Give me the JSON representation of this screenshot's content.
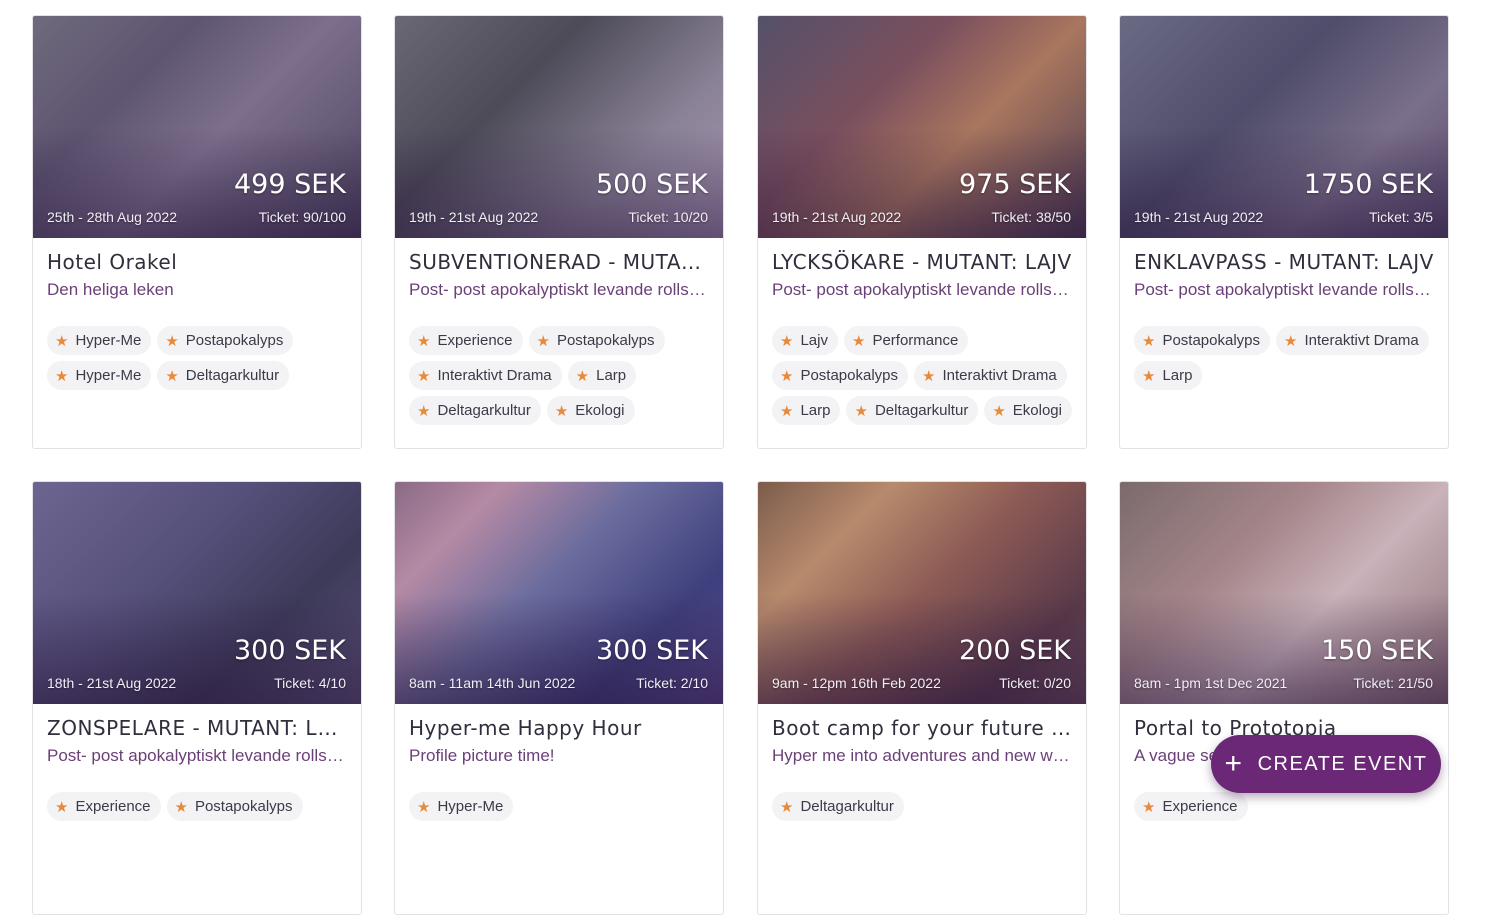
{
  "create_event_label": "CREATE EVENT",
  "accent_color": "#6a2877",
  "tag_star_color": "#e98a3a",
  "cards": [
    {
      "price": "499 SEK",
      "date": "25th - 28th Aug 2022",
      "ticket": "Ticket: 90/100",
      "title": "Hotel Orakel",
      "subtitle": "Den heliga leken",
      "tags": [
        "Hyper-Me",
        "Postapokalyps",
        "Hyper-Me",
        "Deltagarkultur"
      ]
    },
    {
      "price": "500 SEK",
      "date": "19th - 21st Aug 2022",
      "ticket": "Ticket: 10/20",
      "title": "SUBVENTIONERAD - MUTANT: LAJV",
      "subtitle": "Post- post apokalyptiskt levande rollspel",
      "tags": [
        "Experience",
        "Postapokalyps",
        "Interaktivt Drama",
        "Larp",
        "Deltagarkultur",
        "Ekologi"
      ]
    },
    {
      "price": "975 SEK",
      "date": "19th - 21st Aug 2022",
      "ticket": "Ticket: 38/50",
      "title": "LYCKSÖKARE - MUTANT: LAJV",
      "subtitle": "Post- post apokalyptiskt levande rollspel",
      "tags": [
        "Lajv",
        "Performance",
        "Postapokalyps",
        "Interaktivt Drama",
        "Larp",
        "Deltagarkultur",
        "Ekologi"
      ]
    },
    {
      "price": "1750 SEK",
      "date": "19th - 21st Aug 2022",
      "ticket": "Ticket: 3/5",
      "title": "ENKLAVPASS - MUTANT: LAJV",
      "subtitle": "Post- post apokalyptiskt levande rollspel",
      "tags": [
        "Postapokalyps",
        "Interaktivt Drama",
        "Larp"
      ]
    },
    {
      "price": "300 SEK",
      "date": "18th - 21st Aug 2022",
      "ticket": "Ticket: 4/10",
      "title": "ZONSPELARE - MUTANT: LAJV",
      "subtitle": "Post- post apokalyptiskt levande rollspel",
      "tags": [
        "Experience",
        "Postapokalyps"
      ]
    },
    {
      "price": "300 SEK",
      "date": "8am - 11am 14th Jun 2022",
      "ticket": "Ticket: 2/10",
      "title": "Hyper-me Happy Hour",
      "subtitle": "Profile picture time!",
      "tags": [
        "Hyper-Me"
      ]
    },
    {
      "price": "200 SEK",
      "date": "9am - 12pm 16th Feb 2022",
      "ticket": "Ticket: 0/20",
      "title": "Boot camp for your future self",
      "subtitle": "Hyper me into adventures and new worlds",
      "tags": [
        "Deltagarkultur"
      ]
    },
    {
      "price": "150 SEK",
      "date": "8am - 1pm 1st Dec 2021",
      "ticket": "Ticket: 21/50",
      "title": "Portal to Prototopia",
      "subtitle": "A vague sense of portals",
      "tags": [
        "Experience"
      ]
    }
  ]
}
